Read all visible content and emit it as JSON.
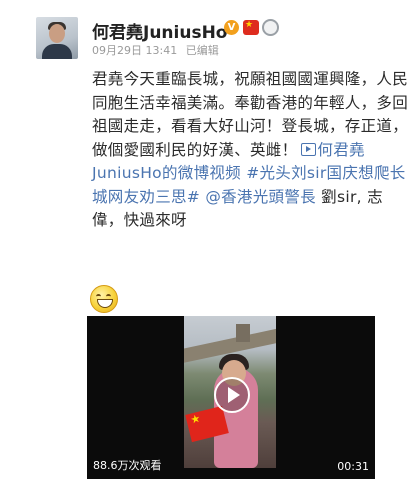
{
  "author": {
    "name": "何君堯JuniusHo",
    "verified_badge": "V"
  },
  "meta": {
    "timestamp": "09月29日 13:41",
    "edited": "已编辑"
  },
  "post": {
    "text_main": "君堯今天重臨長城，祝願祖國國運興隆，人民同胞生活幸福美滿。奉勸香港的年輕人，多回祖國走走，看看大好山河！登長城，存正道，做個愛國利民的好漢、英雌！",
    "video_link": "何君堯JuniusHo的微博视频",
    "hashtag": "#光头刘sir国庆想爬长城网友劝三思#",
    "mention": "@香港光頭警長",
    "text_tail": " 劉sir, 志偉，快過來呀",
    "emoji": "laughing-emoji"
  },
  "video": {
    "views": "88.6万次观看",
    "duration": "00:31"
  },
  "colors": {
    "link": "#4a74b0",
    "text": "#2b2b2b",
    "meta": "#9a9a9a"
  }
}
